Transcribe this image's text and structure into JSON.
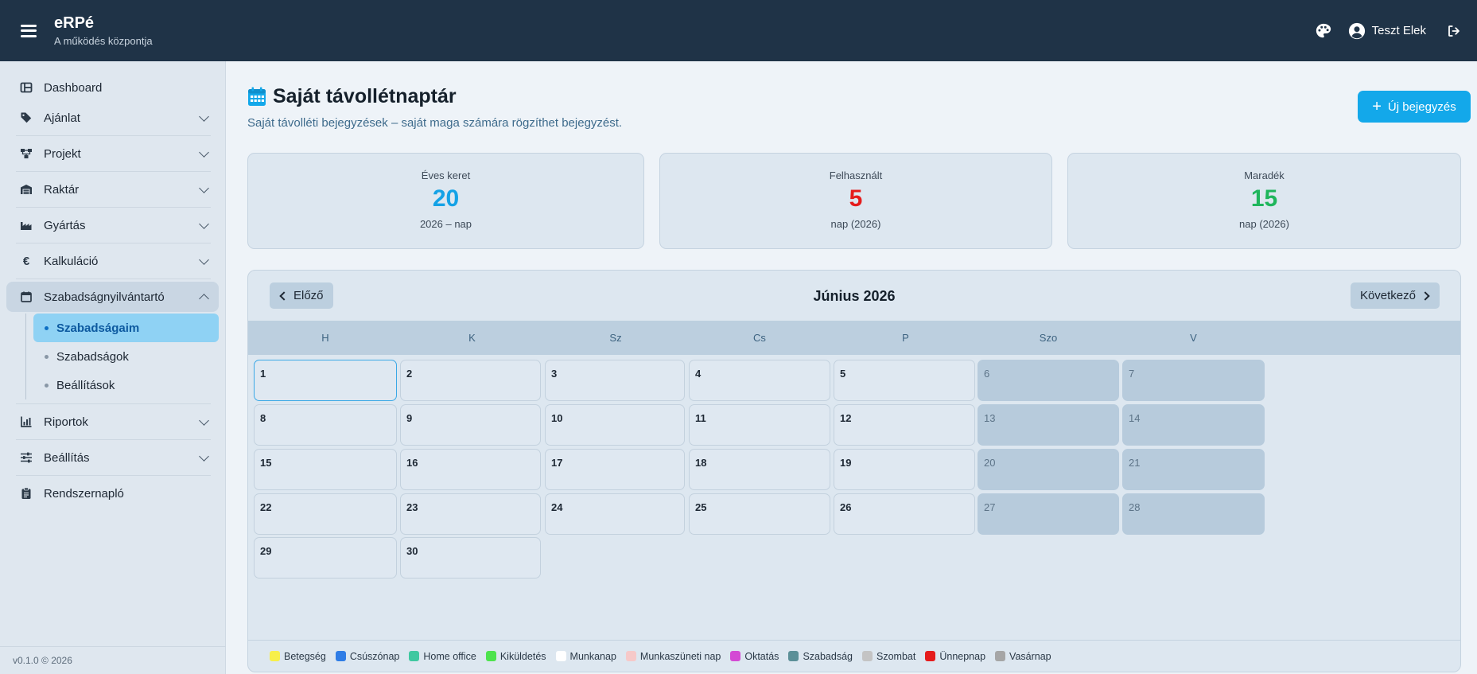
{
  "app": {
    "title": "eRPé",
    "subtitle": "A működés központja"
  },
  "user": {
    "name": "Teszt Elek"
  },
  "sidebar": {
    "items": [
      {
        "label": "Dashboard",
        "icon": "dashboard-icon"
      },
      {
        "label": "Ajánlat",
        "icon": "tag-icon"
      },
      {
        "label": "Projekt",
        "icon": "project-icon"
      },
      {
        "label": "Raktár",
        "icon": "warehouse-icon"
      },
      {
        "label": "Gyártás",
        "icon": "factory-icon"
      },
      {
        "label": "Kalkuláció",
        "icon": "euro-icon"
      },
      {
        "label": "Szabadságnyilvántartó",
        "icon": "calendar-icon"
      },
      {
        "label": "Riportok",
        "icon": "report-icon"
      },
      {
        "label": "Beállítás",
        "icon": "sliders-icon"
      },
      {
        "label": "Rendszernapló",
        "icon": "clipboard-icon"
      }
    ],
    "sub_items": [
      {
        "label": "Szabadságaim"
      },
      {
        "label": "Szabadságok"
      },
      {
        "label": "Beállítások"
      }
    ],
    "version": "v0.1.0 © 2026"
  },
  "page": {
    "title": "Saját távollétnaptár",
    "subtitle": "Saját távolléti bejegyzések – saját maga számára rögzíthet bejegyzést.",
    "new_button": "Új bejegyzés"
  },
  "stats": [
    {
      "label": "Éves keret",
      "value": "20",
      "unit": "2026 – nap",
      "color": "#14a2e6"
    },
    {
      "label": "Felhasznált",
      "value": "5",
      "unit": "nap (2026)",
      "color": "#e51c1c"
    },
    {
      "label": "Maradék",
      "value": "15",
      "unit": "nap (2026)",
      "color": "#1fb65c"
    }
  ],
  "calendar": {
    "prev_label": "Előző",
    "next_label": "Következő",
    "month_title": "Június 2026",
    "weekdays": [
      "H",
      "K",
      "Sz",
      "Cs",
      "P",
      "Szo",
      "V"
    ],
    "days": [
      "1",
      "2",
      "3",
      "4",
      "5",
      "6",
      "7",
      "8",
      "9",
      "10",
      "11",
      "12",
      "13",
      "14",
      "15",
      "16",
      "17",
      "18",
      "19",
      "20",
      "21",
      "22",
      "23",
      "24",
      "25",
      "26",
      "27",
      "28",
      "29",
      "30"
    ]
  },
  "legend": [
    {
      "label": "Betegség",
      "color": "#f7ef4a"
    },
    {
      "label": "Csúszónap",
      "color": "#2f7de6"
    },
    {
      "label": "Home office",
      "color": "#3fc8a0"
    },
    {
      "label": "Kiküldetés",
      "color": "#4ee34e"
    },
    {
      "label": "Munkanap",
      "color": "#ffffff"
    },
    {
      "label": "Munkaszüneti nap",
      "color": "#f6c9c9"
    },
    {
      "label": "Oktatás",
      "color": "#d44ad4"
    },
    {
      "label": "Szabadság",
      "color": "#5c9098"
    },
    {
      "label": "Szombat",
      "color": "#c4c4c4"
    },
    {
      "label": "Ünnepnap",
      "color": "#e51c1c"
    },
    {
      "label": "Vasárnap",
      "color": "#a6a6a6"
    }
  ]
}
